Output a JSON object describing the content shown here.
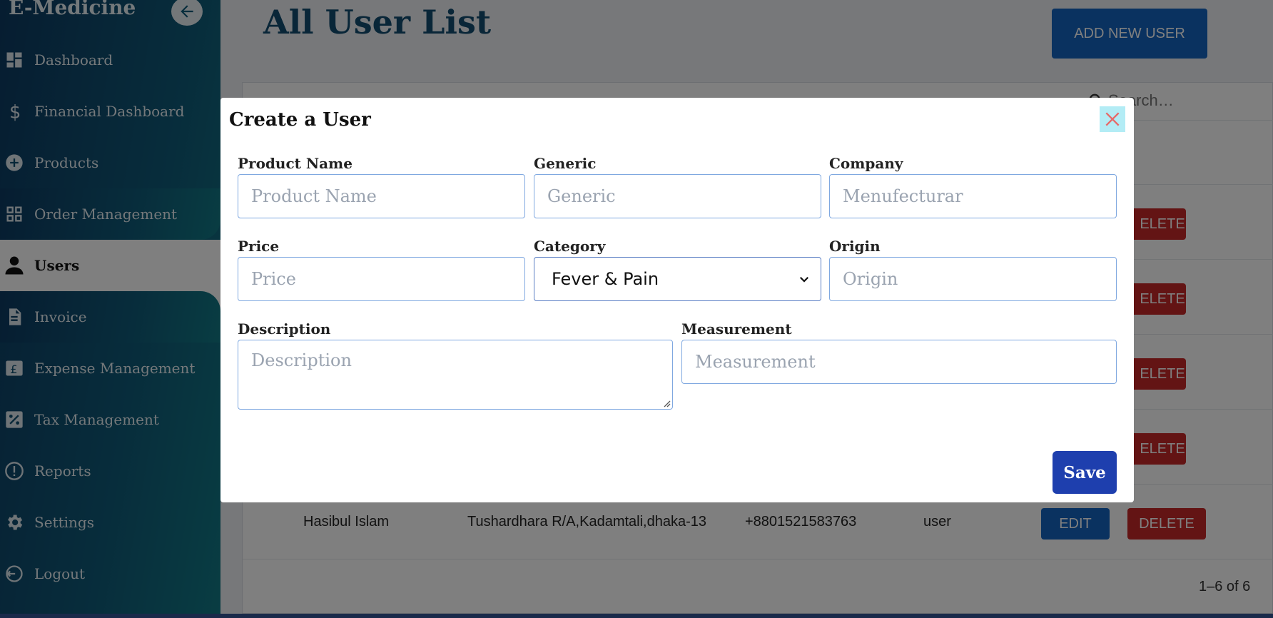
{
  "sidebar": {
    "brand": "E-Medicine",
    "items": [
      {
        "label": "Dashboard",
        "icon": "dashboard-icon"
      },
      {
        "label": "Financial Dashboard",
        "icon": "dollar-icon"
      },
      {
        "label": "Products",
        "icon": "add-circle-icon"
      },
      {
        "label": "Order Management",
        "icon": "grid-icon"
      },
      {
        "label": "Users",
        "icon": "person-icon"
      },
      {
        "label": "Invoice",
        "icon": "document-icon"
      },
      {
        "label": "Expense Management",
        "icon": "pound-icon"
      },
      {
        "label": "Tax Management",
        "icon": "percent-icon"
      },
      {
        "label": "Reports",
        "icon": "alert-circle-icon"
      },
      {
        "label": "Settings",
        "icon": "gear-icon"
      },
      {
        "label": "Logout",
        "icon": "logout-icon"
      }
    ]
  },
  "main": {
    "title": "All User List",
    "add_button": "ADD NEW USER",
    "search_placeholder": "Search…",
    "delete_label_partial": "ELETE",
    "last_row": {
      "name": "Hasibul Islam",
      "address": "Tushardhara R/A,Kadamtali,dhaka-13",
      "phone": "+8801521583763",
      "role": "user",
      "edit": "EDIT",
      "delete": "DELETE"
    },
    "pagination": "1–6 of 6"
  },
  "modal": {
    "title": "Create a User",
    "fields": {
      "product_name": {
        "label": "Product Name",
        "placeholder": "Product Name"
      },
      "generic": {
        "label": "Generic",
        "placeholder": "Generic"
      },
      "company": {
        "label": "Company",
        "placeholder": "Menufecturar"
      },
      "price": {
        "label": "Price",
        "placeholder": "Price"
      },
      "category": {
        "label": "Category",
        "value": "Fever & Pain"
      },
      "origin": {
        "label": "Origin",
        "placeholder": "Origin"
      },
      "description": {
        "label": "Description",
        "placeholder": "Description"
      },
      "measurement": {
        "label": "Measurement",
        "placeholder": "Measurement"
      }
    },
    "save_button": "Save"
  },
  "colors": {
    "sidebar_start": "#0d3a62",
    "sidebar_end": "#127a86",
    "primary": "#1565c0",
    "danger": "#c62828",
    "save": "#1e3fae",
    "title": "#124d70"
  }
}
